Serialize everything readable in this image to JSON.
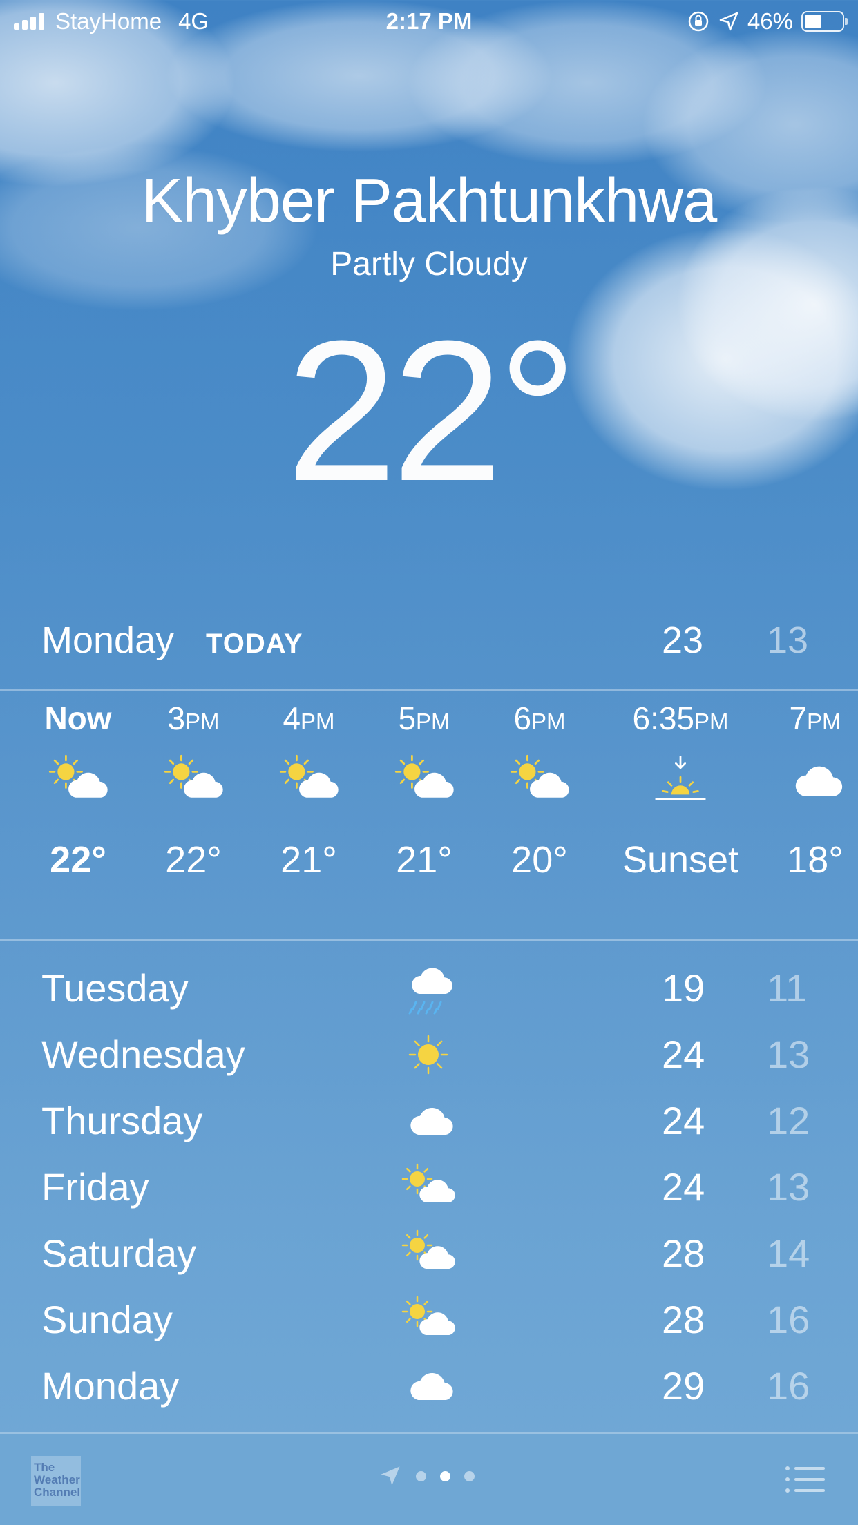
{
  "status_bar": {
    "carrier": "StayHome",
    "network": "4G",
    "time": "2:17 PM",
    "battery": "46%",
    "battery_level": 0.46
  },
  "location": {
    "city": "Khyber Pakhtunkhwa",
    "condition": "Partly Cloudy",
    "temperature": "22°"
  },
  "today": {
    "day": "Monday",
    "label": "TODAY",
    "high": "23",
    "low": "13"
  },
  "hourly": [
    {
      "time": "Now",
      "suffix": "",
      "icon": "partly-cloudy-icon",
      "temp": "22°"
    },
    {
      "time": "3",
      "suffix": "PM",
      "icon": "partly-cloudy-icon",
      "temp": "22°"
    },
    {
      "time": "4",
      "suffix": "PM",
      "icon": "partly-cloudy-icon",
      "temp": "21°"
    },
    {
      "time": "5",
      "suffix": "PM",
      "icon": "partly-cloudy-icon",
      "temp": "21°"
    },
    {
      "time": "6",
      "suffix": "PM",
      "icon": "partly-cloudy-icon",
      "temp": "20°"
    },
    {
      "time": "6:35",
      "suffix": "PM",
      "icon": "sunset-icon",
      "temp": "Sunset"
    },
    {
      "time": "7",
      "suffix": "PM",
      "icon": "cloud-icon",
      "temp": "18°"
    }
  ],
  "daily": [
    {
      "day": "Tuesday",
      "icon": "rain-cloud-icon",
      "high": "19",
      "low": "11"
    },
    {
      "day": "Wednesday",
      "icon": "sun-icon",
      "high": "24",
      "low": "13"
    },
    {
      "day": "Thursday",
      "icon": "cloud-icon",
      "high": "24",
      "low": "12"
    },
    {
      "day": "Friday",
      "icon": "partly-cloudy-icon",
      "high": "24",
      "low": "13"
    },
    {
      "day": "Saturday",
      "icon": "partly-cloudy-icon",
      "high": "28",
      "low": "14"
    },
    {
      "day": "Sunday",
      "icon": "partly-cloudy-icon",
      "high": "28",
      "low": "16"
    },
    {
      "day": "Monday",
      "icon": "cloud-icon",
      "high": "29",
      "low": "16"
    }
  ],
  "bottom_bar": {
    "logo_text": "The Weather Channel",
    "pages": 3,
    "active_page": 1
  },
  "colors": {
    "sun": "#f5d442",
    "rain": "#5ab4f0"
  }
}
